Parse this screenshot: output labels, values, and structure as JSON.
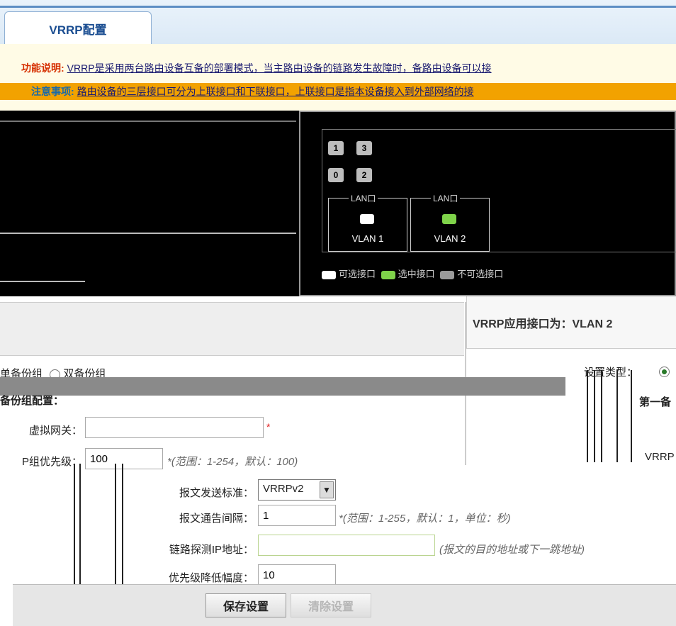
{
  "tab": {
    "title": "VRRP配置"
  },
  "notice": {
    "desc_tag": "功能说明:",
    "desc_text": "VRRP是采用两台路由设备互备的部署模式，当主路由设备的链路发生故障时，备路由设备可以接",
    "warn_tag": "注意事项:",
    "warn_text": "路由设备的三层接口可分为上联接口和下联接口，上联接口是指本设备接入到外部网络的接"
  },
  "diagram": {
    "ports": [
      "1",
      "3",
      "0",
      "2"
    ],
    "lan_label": "LAN口",
    "lans": [
      {
        "vlan": "VLAN 1",
        "color": "#ffffff"
      },
      {
        "vlan": "VLAN 2",
        "color": "#7fd34a"
      }
    ],
    "legend": [
      {
        "text": "可选接口",
        "color": "#ffffff"
      },
      {
        "text": "选中接口",
        "color": "#7fd34a"
      },
      {
        "text": "不可选接口",
        "color": "#9a9a9a"
      }
    ]
  },
  "config": {
    "apply_interface_title": "VRRP应用接口为：VLAN 2",
    "single_backup": "单备份组",
    "dual_backup": "双备份组",
    "set_type_label": "设置类型：",
    "group_config_title": "备份组配置：",
    "first_group_title": "第一备",
    "vrrp_frag": "VRRP",
    "virtual_gateway_label": "虚拟网关：",
    "virtual_gateway_value": "",
    "priority_label": "P组优先级：",
    "priority_value": "100",
    "priority_hint": "*(范围：1-254，默认：100)",
    "send_std_label": "报文发送标准：",
    "send_std_value": "VRRPv2",
    "adv_interval_label": "报文通告间隔：",
    "adv_interval_value": "1",
    "adv_interval_hint": "*(范围：1-255，默认：1，单位：秒)",
    "probe_ip_label": "链路探测IP地址：",
    "probe_ip_value": "",
    "probe_ip_hint": "(报文的目的地址或下一跳地址)",
    "priority_reduce_label": "优先级降低幅度：",
    "priority_reduce_value": "10"
  },
  "buttons": {
    "save": "保存设置",
    "clear": "清除设置"
  }
}
